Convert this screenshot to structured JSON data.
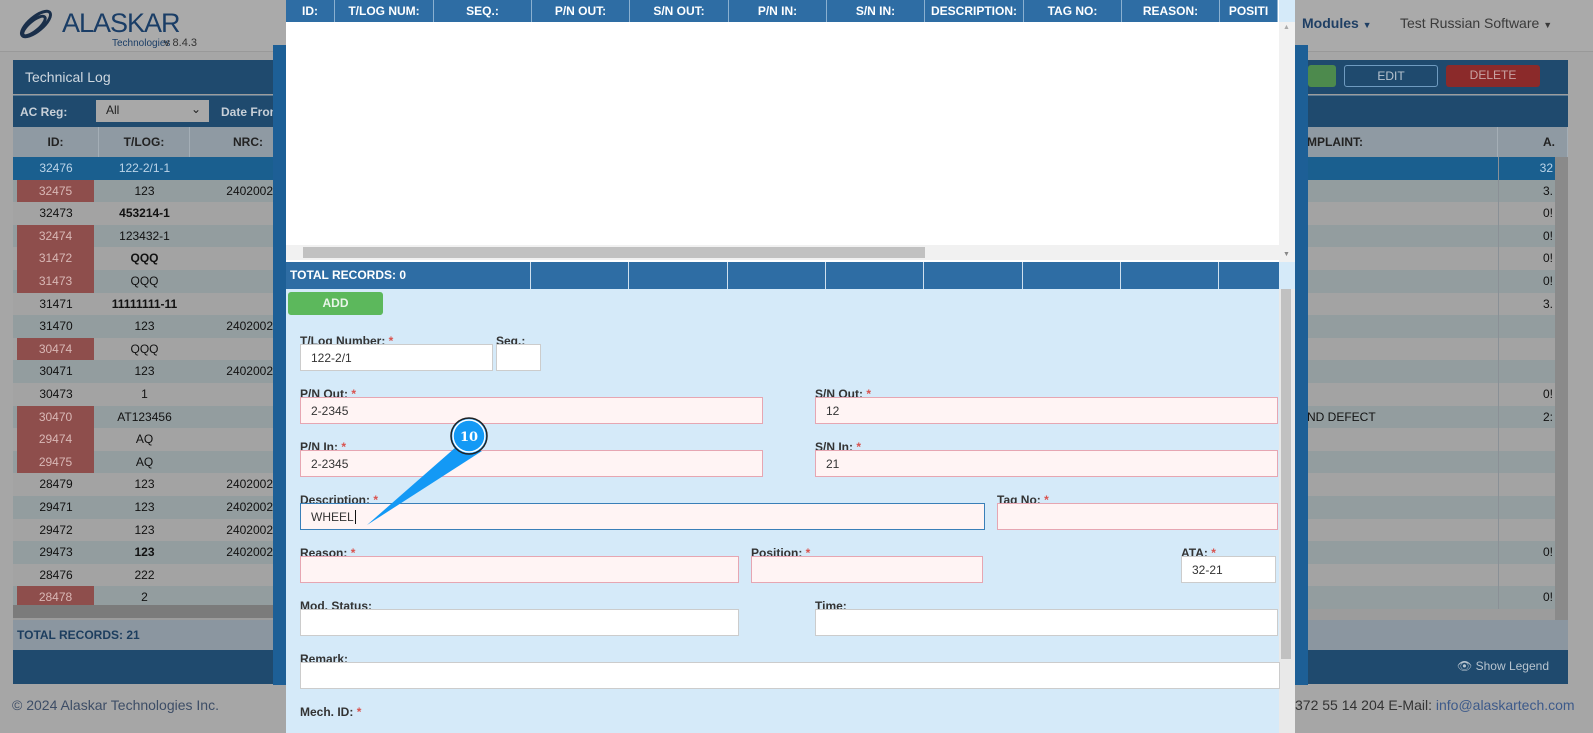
{
  "app": {
    "brand": "ALASKAR",
    "sub": "Technologies",
    "version": "v 8.4.3",
    "nav_modules": "Modules",
    "nav_user": "Test Russian Software"
  },
  "panel": {
    "title": "Technical Log",
    "ac_reg_label": "AC Reg:",
    "ac_reg_value": "All",
    "date_from_label": "Date From",
    "edit": "EDIT",
    "delete": "DELETE",
    "columns": [
      "ID:",
      "T/LOG:",
      "NRC:",
      "MPLAINT:",
      "A."
    ],
    "rows": [
      {
        "id": "32476",
        "tlog": "122-2/1-1",
        "nrc": "",
        "complaint": "",
        "a": "32",
        "red": false,
        "bold": false,
        "sel": true
      },
      {
        "id": "32475",
        "tlog": "123",
        "nrc": "2402002",
        "complaint": "",
        "a": "3.",
        "red": true,
        "bold": false
      },
      {
        "id": "32473",
        "tlog": "453214-1",
        "nrc": "",
        "complaint": "",
        "a": "0!",
        "red": false,
        "bold": true
      },
      {
        "id": "32474",
        "tlog": "123432-1",
        "nrc": "",
        "complaint": "",
        "a": "0!",
        "red": true,
        "bold": false
      },
      {
        "id": "31472",
        "tlog": "QQQ",
        "nrc": "",
        "complaint": "",
        "a": "0!",
        "red": true,
        "bold": true
      },
      {
        "id": "31473",
        "tlog": "QQQ",
        "nrc": "",
        "complaint": "",
        "a": "0!",
        "red": true,
        "bold": false
      },
      {
        "id": "31471",
        "tlog": "11111111-11",
        "nrc": "",
        "complaint": "",
        "a": "3.",
        "red": false,
        "bold": true
      },
      {
        "id": "31470",
        "tlog": "123",
        "nrc": "2402002",
        "complaint": "",
        "a": "",
        "red": false,
        "bold": false
      },
      {
        "id": "30474",
        "tlog": "QQQ",
        "nrc": "",
        "complaint": "",
        "a": "",
        "red": true,
        "bold": false
      },
      {
        "id": "30471",
        "tlog": "123",
        "nrc": "2402002",
        "complaint": "",
        "a": "",
        "red": false,
        "bold": false
      },
      {
        "id": "30473",
        "tlog": "1",
        "nrc": "",
        "complaint": "",
        "a": "0!",
        "red": false,
        "bold": false
      },
      {
        "id": "30470",
        "tlog": "AT123456",
        "nrc": "",
        "complaint": "ND DEFECT",
        "a": "2:",
        "red": true,
        "bold": false
      },
      {
        "id": "29474",
        "tlog": "AQ",
        "nrc": "",
        "complaint": "",
        "a": "",
        "red": true,
        "bold": false
      },
      {
        "id": "29475",
        "tlog": "AQ",
        "nrc": "",
        "complaint": "",
        "a": "",
        "red": true,
        "bold": false
      },
      {
        "id": "28479",
        "tlog": "123",
        "nrc": "2402002",
        "complaint": "",
        "a": "",
        "red": false,
        "bold": false
      },
      {
        "id": "29471",
        "tlog": "123",
        "nrc": "2402002",
        "complaint": "",
        "a": "",
        "red": false,
        "bold": false
      },
      {
        "id": "29472",
        "tlog": "123",
        "nrc": "2402002",
        "complaint": "",
        "a": "",
        "red": false,
        "bold": false
      },
      {
        "id": "29473",
        "tlog": "123",
        "nrc": "2402002",
        "complaint": "",
        "a": "0!",
        "red": false,
        "bold": true
      },
      {
        "id": "28476",
        "tlog": "222",
        "nrc": "",
        "complaint": "",
        "a": "",
        "red": false,
        "bold": false
      },
      {
        "id": "28478",
        "tlog": "2",
        "nrc": "",
        "complaint": "",
        "a": "0!",
        "red": true,
        "bold": false
      }
    ],
    "total": "TOTAL RECORDS: 21",
    "show_legend": "Show Legend"
  },
  "footer": {
    "copyright": "© 2024 Alaskar Technologies Inc.",
    "contact": "372 55 14 204 E-Mail: ",
    "email": "info@alaskartech.com"
  },
  "modal": {
    "columns": [
      "ID:",
      "T/LOG NUM:",
      "SEQ.:",
      "P/N OUT:",
      "S/N OUT:",
      "P/N IN:",
      "S/N IN:",
      "DESCRIPTION:",
      "TAG NO:",
      "REASON:",
      "POSITI"
    ],
    "total": "TOTAL RECORDS: 0",
    "add": "ADD",
    "form": {
      "tlog_label": "T/Log Number:",
      "tlog": "122-2/1",
      "seq_label": "Seq.:",
      "seq": "",
      "pn_out_label": "P/N Out:",
      "pn_out": "2-2345",
      "sn_out_label": "S/N Out:",
      "sn_out": "12",
      "pn_in_label": "P/N In:",
      "pn_in": "2-2345",
      "sn_in_label": "S/N In:",
      "sn_in": "21",
      "desc_label": "Description:",
      "desc": "WHEEL",
      "tag_label": "Tag No:",
      "tag": "",
      "reason_label": "Reason:",
      "reason": "",
      "position_label": "Position:",
      "position": "",
      "ata_label": "ATA:",
      "ata": "32-21",
      "mod_label": "Mod. Status:",
      "mod": "",
      "time_label": "Time:",
      "time": "",
      "remark_label": "Remark:",
      "remark": "",
      "mech_label": "Mech. ID:",
      "req": "*"
    }
  },
  "callout": {
    "step": "10",
    "color": "#1399f5"
  }
}
